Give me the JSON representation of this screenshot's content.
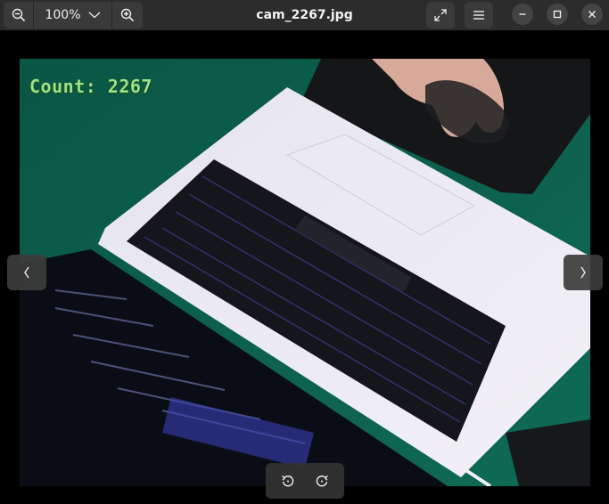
{
  "window": {
    "title": "cam_2267.jpg"
  },
  "toolbar": {
    "zoom_level": "100%"
  },
  "image": {
    "overlay_text": "Count: 2267"
  },
  "icons": {
    "zoom_out": "zoom-out-icon",
    "zoom_in": "zoom-in-icon",
    "zoom_menu": "chevron-down-icon",
    "fullscreen": "fullscreen-icon",
    "menu": "hamburger-menu-icon",
    "minimize": "minimize-icon",
    "maximize": "maximize-icon",
    "close": "close-icon",
    "previous": "chevron-left-icon",
    "next": "chevron-right-icon",
    "rotate_left": "rotate-left-icon",
    "rotate_right": "rotate-right-icon"
  },
  "colors": {
    "headerbar": "#2c2c2c",
    "button": "#3a3a3a",
    "overlay_text": "#9be08a",
    "desk": "#0d5b49"
  }
}
